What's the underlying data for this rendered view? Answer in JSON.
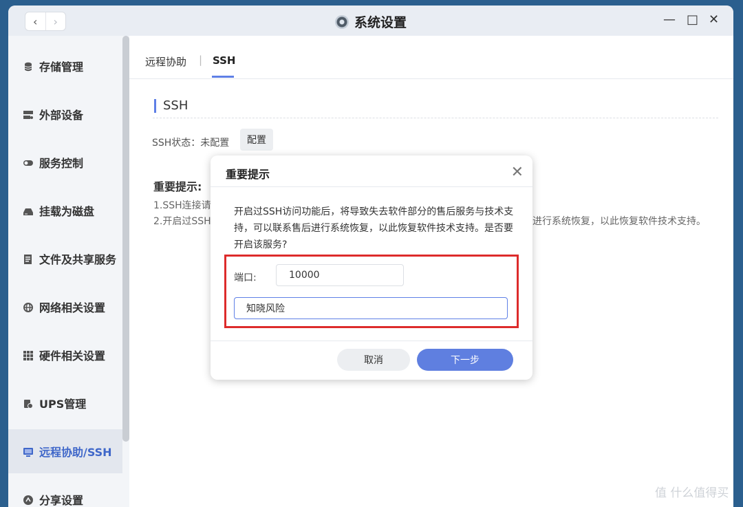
{
  "window": {
    "title": "系统设置",
    "back": "‹",
    "forward": "›",
    "minimize": "—",
    "maximize": "□",
    "close": "✕"
  },
  "sidebar": {
    "items": [
      {
        "label": "存储管理",
        "icon": "database-icon"
      },
      {
        "label": "外部设备",
        "icon": "server-icon"
      },
      {
        "label": "服务控制",
        "icon": "toggle-icon"
      },
      {
        "label": "挂载为磁盘",
        "icon": "drive-icon"
      },
      {
        "label": "文件及共享服务",
        "icon": "document-icon"
      },
      {
        "label": "网络相关设置",
        "icon": "globe-icon"
      },
      {
        "label": "硬件相关设置",
        "icon": "grid-icon"
      },
      {
        "label": "UPS管理",
        "icon": "battery-icon"
      },
      {
        "label": "远程协助/SSH",
        "icon": "monitor-icon",
        "active": true
      },
      {
        "label": "分享设置",
        "icon": "share-icon"
      }
    ]
  },
  "tabs": [
    {
      "label": "远程协助"
    },
    {
      "label": "SSH",
      "active": true
    }
  ],
  "tab_separator": "|",
  "ssh": {
    "heading": "SSH",
    "status_label": "SSH状态：未配置",
    "config_button": "配置",
    "notice_title": "重要提示:",
    "notice_1": "1.SSH连接请",
    "notice_2": "2.开启过SSH",
    "notice_2_tail": "进行系统恢复，以此恢复软件技术支持。"
  },
  "dialog": {
    "title": "重要提示",
    "close": "✕",
    "message": "开启过SSH访问功能后，将导致失去软件部分的售后服务与技术支持，可以联系售后进行系统恢复，以此恢复软件技术支持。是否要开启该服务?",
    "port_label": "端口:",
    "port_value": "10000",
    "ack_value": "知晓风险",
    "cancel": "取消",
    "next": "下一步"
  },
  "watermark": "值 什么值得买",
  "colors": {
    "accent": "#5e7fe6",
    "highlight_box": "#dd2b2b",
    "desktop": "#2b5f8e"
  }
}
